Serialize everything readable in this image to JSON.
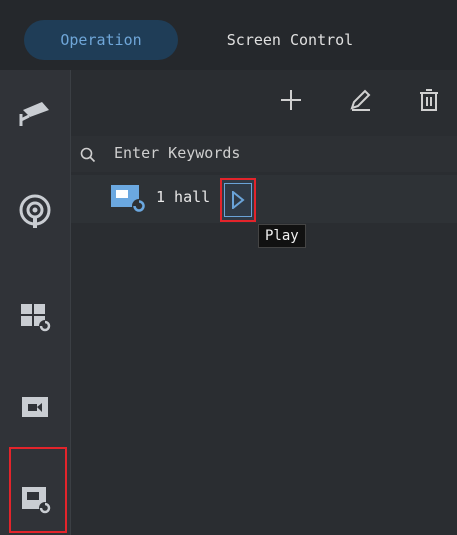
{
  "tabs": {
    "operation": "Operation",
    "screen_control": "Screen Control"
  },
  "sidebar": {
    "items": [
      {
        "icon": "camera-icon"
      },
      {
        "icon": "podcast-icon"
      },
      {
        "icon": "multiscreen-refresh-icon"
      },
      {
        "icon": "video-icon"
      },
      {
        "icon": "scene-icon",
        "selected": true
      }
    ]
  },
  "toolbar": {
    "add_icon": "plus-icon",
    "edit_icon": "edit-icon",
    "delete_icon": "trash-icon"
  },
  "search": {
    "placeholder": "Enter Keywords"
  },
  "tree": {
    "items": [
      {
        "label": "1 hall"
      }
    ]
  },
  "tooltip": {
    "text": "Play"
  },
  "colors": {
    "accent": "#6fa6d8",
    "highlight": "#e3242b"
  }
}
